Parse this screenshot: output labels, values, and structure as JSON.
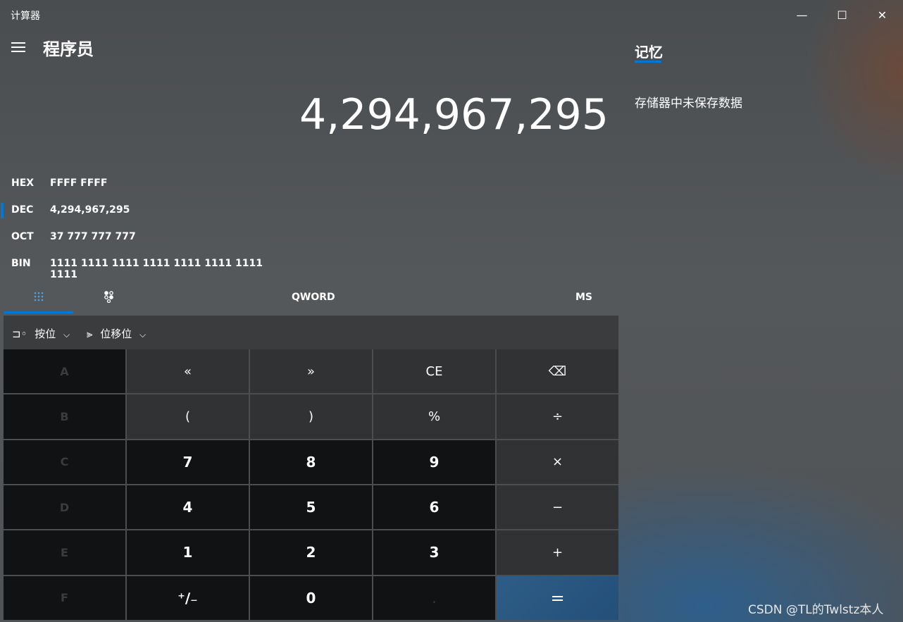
{
  "window": {
    "title": "计算器",
    "minimize": "—",
    "maximize": "☐",
    "close": "✕"
  },
  "header": {
    "mode": "程序员"
  },
  "display": {
    "value": "4,294,967,295"
  },
  "radix": [
    {
      "label": "HEX",
      "value": "FFFF FFFF",
      "selected": false
    },
    {
      "label": "DEC",
      "value": "4,294,967,295",
      "selected": true
    },
    {
      "label": "OCT",
      "value": "37 777 777 777",
      "selected": false
    },
    {
      "label": "BIN",
      "value": "1111 1111 1111 1111 1111 1111 1111 1111",
      "selected": false
    }
  ],
  "tabs": {
    "keypad_icon": "keypad-icon",
    "bit_toggle_icon": "bit-toggle-icon",
    "word_size": "QWORD",
    "memory_store": "MS"
  },
  "operators": {
    "bitwise": "按位",
    "bitshift": "位移位"
  },
  "keys": {
    "A": "A",
    "lsh": "«",
    "rsh": "»",
    "ce": "CE",
    "back": "⌫",
    "B": "B",
    "lparen": "(",
    "rparen": ")",
    "mod": "%",
    "div": "÷",
    "C": "C",
    "k7": "7",
    "k8": "8",
    "k9": "9",
    "mul": "×",
    "D": "D",
    "k4": "4",
    "k5": "5",
    "k6": "6",
    "sub": "−",
    "E": "E",
    "k1": "1",
    "k2": "2",
    "k3": "3",
    "add": "+",
    "F": "F",
    "neg": "⁺∕₋",
    "k0": "0",
    "dot": ".",
    "eq": "="
  },
  "memory": {
    "title": "记忆",
    "empty": "存储器中未保存数据"
  },
  "watermark": "CSDN @TL的Twlstz本人",
  "colors": {
    "accent": "#0078d7",
    "equals": "#2d5d86"
  }
}
